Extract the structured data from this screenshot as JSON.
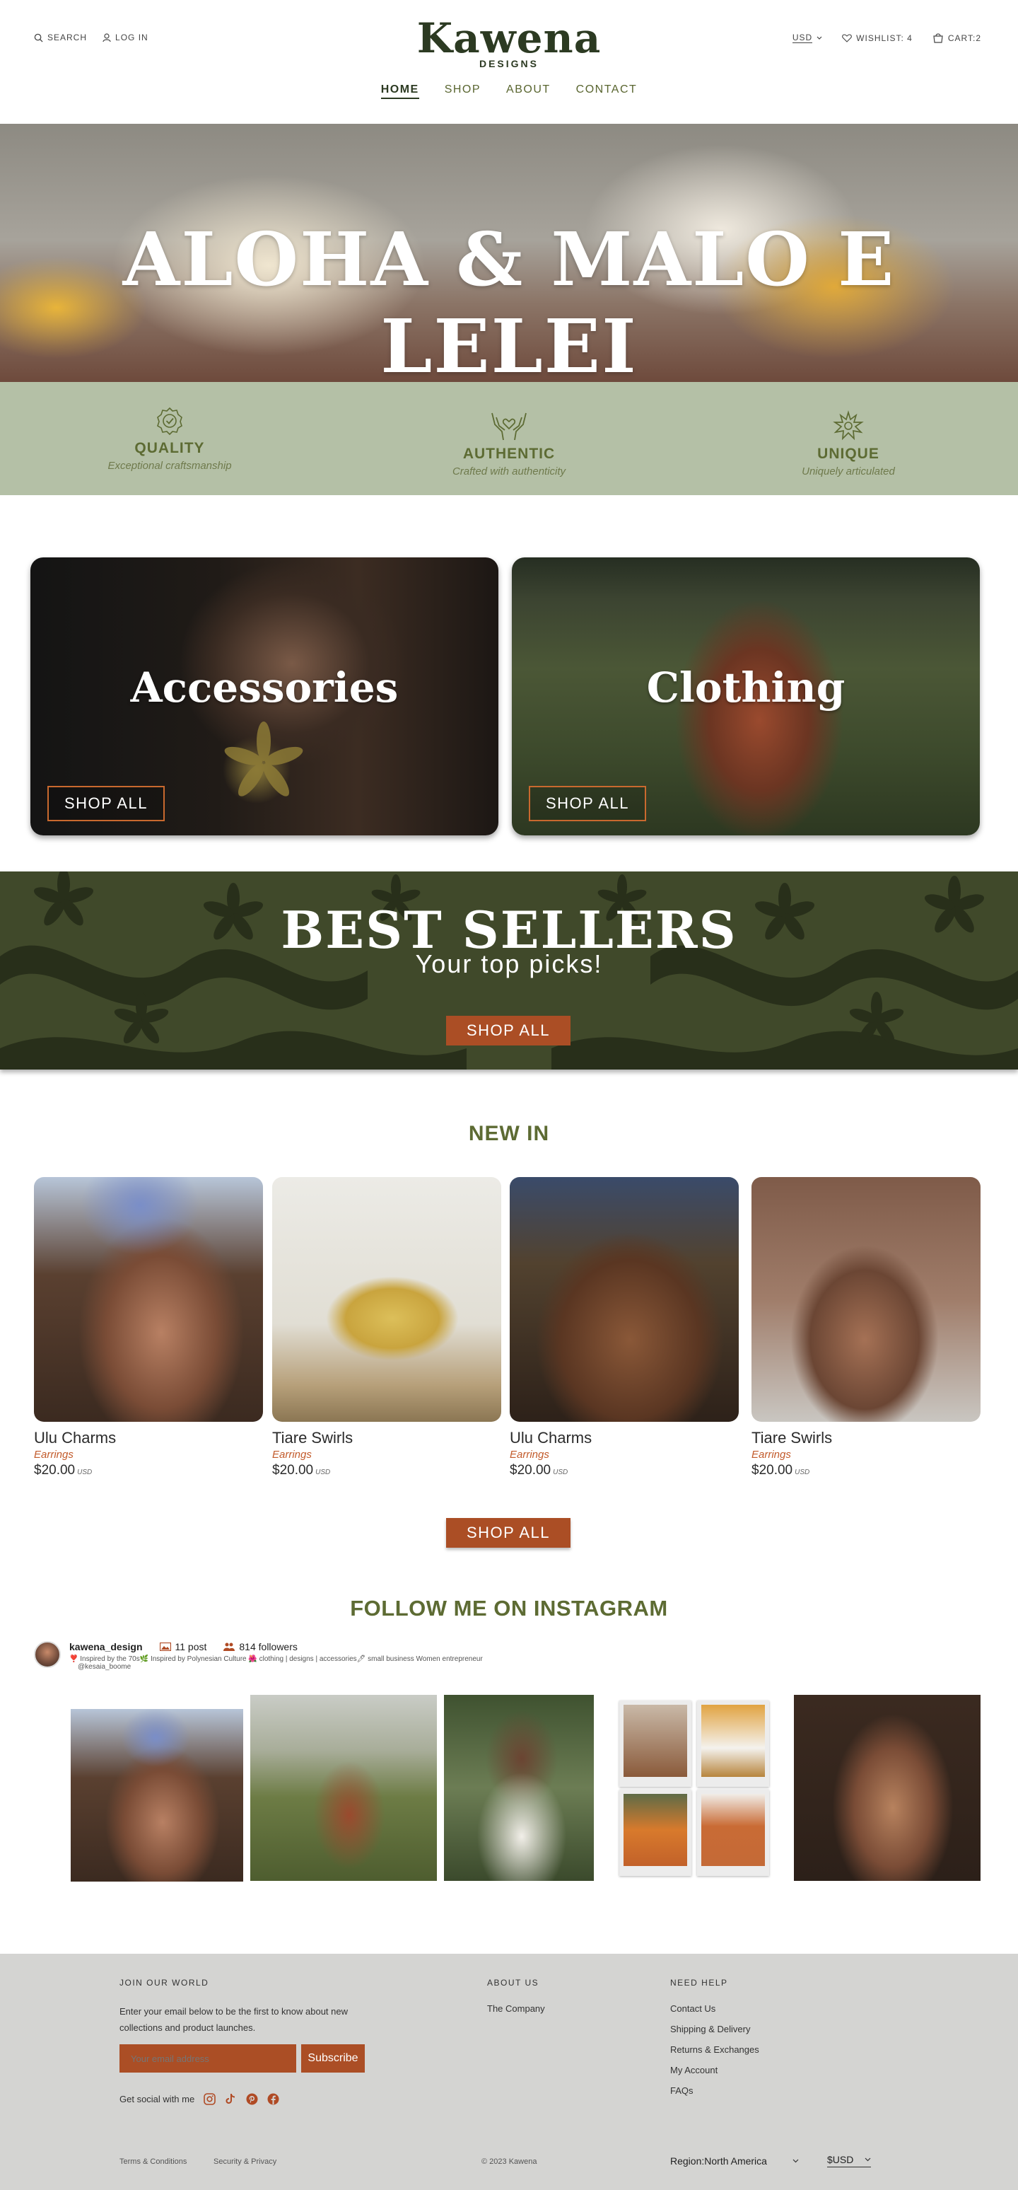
{
  "header": {
    "search_label": "SEARCH",
    "login_label": "LOG IN",
    "logo_main": "Kawena",
    "logo_sub": "DESIGNS",
    "currency": "USD",
    "wishlist_label": "WISHLIST: 4",
    "cart_label": "CART:2",
    "nav": [
      "HOME",
      "SHOP",
      "ABOUT",
      "CONTACT"
    ]
  },
  "hero": {
    "title": "ALOHA & MALO E LELEI"
  },
  "features": [
    {
      "title": "QUALITY",
      "sub": "Exceptional craftsmanship",
      "icon": "badge-check-icon"
    },
    {
      "title": "AUTHENTIC",
      "sub": "Crafted with authenticity",
      "icon": "hands-heart-icon"
    },
    {
      "title": "UNIQUE",
      "sub": "Uniquely articulated",
      "icon": "sparkle-icon"
    }
  ],
  "categories": [
    {
      "title": "Accessories",
      "button": "SHOP ALL"
    },
    {
      "title": "Clothing",
      "button": "SHOP ALL"
    }
  ],
  "best_sellers": {
    "title": "BEST SELLERS",
    "subtitle": "Your top picks!",
    "button": "SHOP ALL"
  },
  "new_in": {
    "title": "NEW IN",
    "products": [
      {
        "name": "Ulu Charms",
        "category": "Earrings",
        "price": "$20.00",
        "currency": "USD"
      },
      {
        "name": "Tiare Swirls",
        "category": "Earrings",
        "price": "$20.00",
        "currency": "USD"
      },
      {
        "name": "Ulu Charms",
        "category": "Earrings",
        "price": "$20.00",
        "currency": "USD"
      },
      {
        "name": "Tiare Swirls",
        "category": "Earrings",
        "price": "$20.00",
        "currency": "USD"
      }
    ],
    "button": "SHOP ALL"
  },
  "instagram": {
    "title": "FOLLOW ME ON INSTAGRAM",
    "handle": "kawena_design",
    "posts": "11 post",
    "followers": "814 followers",
    "bio": "❣️ Inspired by the 70s🌿 Inspired by Polynesian Culture 🌺 clothing | designs | accessories🖊 small business Women entrepreneur",
    "link": "@kesaia_boome"
  },
  "footer": {
    "join_title": "JOIN OUR WORLD",
    "join_text": "Enter your email below to be the first to know about new collections and product launches.",
    "email_placeholder": "Your email address",
    "subscribe": "Subscribe",
    "social_label": "Get social with me",
    "about_title": "ABOUT US",
    "about_links": [
      "The Company"
    ],
    "help_title": "NEED HELP",
    "help_links": [
      "Contact Us",
      "Shipping & Delivery",
      "Returns & Exchanges",
      "My Account",
      "FAQs"
    ],
    "terms": "Terms & Conditions",
    "privacy": "Security & Privacy",
    "copyright": "© 2023 Kawena",
    "region": "Region:North America",
    "currency": "$USD"
  },
  "colors": {
    "olive": "#5d6b33",
    "rust": "#ab4e25",
    "sage": "#b4c0a6",
    "dark_green": "#40492a"
  }
}
